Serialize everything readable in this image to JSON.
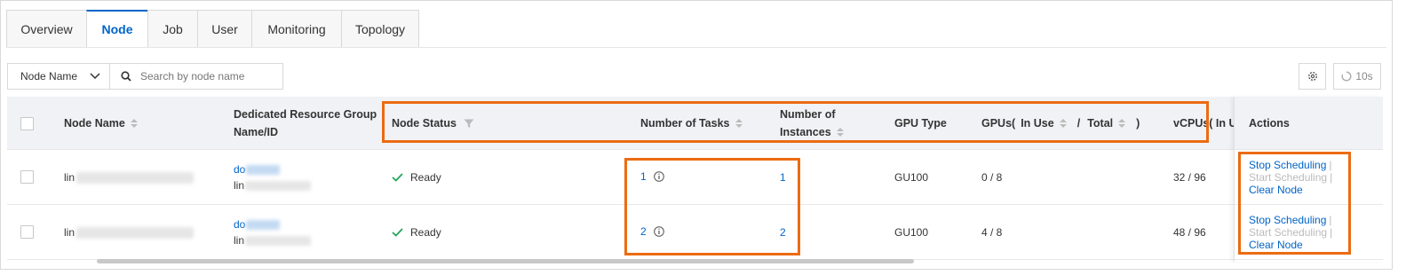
{
  "tabs": [
    {
      "label": "Overview",
      "active": false
    },
    {
      "label": "Node",
      "active": true
    },
    {
      "label": "Job",
      "active": false
    },
    {
      "label": "User",
      "active": false
    },
    {
      "label": "Monitoring",
      "active": false
    },
    {
      "label": "Topology",
      "active": false
    }
  ],
  "toolbar": {
    "filter_field": "Node Name",
    "search_placeholder": "Search by node name",
    "settings_icon": "gear-icon",
    "refresh_label": "10s"
  },
  "table": {
    "headers": {
      "node_name": "Node Name",
      "resource_group_line1": "Dedicated Resource Group",
      "resource_group_line2": "Name/ID",
      "node_status": "Node Status",
      "num_tasks": "Number of Tasks",
      "num_instances_line1": "Number of",
      "num_instances_line2": "Instances",
      "gpu_type": "GPU Type",
      "gpus_prefix": "GPUs(",
      "gpus_in_use": "In Use",
      "gpus_sep": "/",
      "gpus_total": "Total",
      "gpus_suffix": ")",
      "vcpus": "vCPUs( In Us",
      "actions": "Actions"
    },
    "rows": [
      {
        "node_name_visible": "lin",
        "group_name_visible": "do",
        "group_id_visible": "lin",
        "status": "Ready",
        "tasks": "1",
        "instances": "1",
        "gpu_type": "GU100",
        "gpus": "0 / 8",
        "vcpus": "32 / 96",
        "actions": {
          "stop": "Stop Scheduling",
          "start": "Start Scheduling",
          "clear": "Clear Node"
        }
      },
      {
        "node_name_visible": "lin",
        "group_name_visible": "do",
        "group_id_visible": "lin",
        "status": "Ready",
        "tasks": "2",
        "instances": "2",
        "gpu_type": "GU100",
        "gpus": "4 / 8",
        "vcpus": "48 / 96",
        "actions": {
          "stop": "Stop Scheduling",
          "start": "Start Scheduling",
          "clear": "Clear Node"
        }
      }
    ]
  },
  "colors": {
    "accent": "#0064c8",
    "highlight": "#ec6b12",
    "ready": "#23a55a",
    "header_bg": "#f0f2f5"
  }
}
